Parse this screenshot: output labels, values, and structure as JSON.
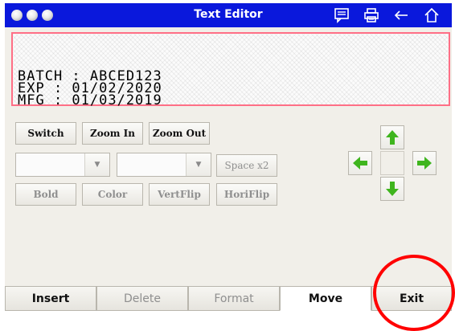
{
  "window": {
    "title": "Text Editor",
    "icons": [
      "traffic-light-dot",
      "message-icon",
      "printer-icon",
      "back-arrow-icon",
      "home-icon"
    ],
    "title_bar_color": "#0a18dc"
  },
  "preview": {
    "lines": [
      "BATCH : ABCED123",
      "EXP : 01/02/2020",
      "MFG : 01/03/2019"
    ],
    "border_color": "#ff6f86"
  },
  "toolbar": {
    "switch_label": "Switch",
    "zoom_in_label": "Zoom In",
    "zoom_out_label": "Zoom Out",
    "space_label": "Space x2",
    "bold_label": "Bold",
    "color_label": "Color",
    "vert_flip_label": "VertFlip",
    "hori_flip_label": "HoriFlip",
    "font_select_value": "",
    "size_select_value": ""
  },
  "move_pad": {
    "icons": [
      "arrow-up-icon",
      "arrow-left-icon",
      "arrow-right-icon",
      "arrow-down-icon"
    ],
    "arrow_color": "#3fb51e"
  },
  "tabs": [
    {
      "label": "Insert",
      "state": "enabled"
    },
    {
      "label": "Delete",
      "state": "disabled"
    },
    {
      "label": "Format",
      "state": "disabled"
    },
    {
      "label": "Move",
      "state": "active"
    },
    {
      "label": "Exit",
      "state": "enabled"
    }
  ],
  "annotation": {
    "highlight_color": "#ff0000",
    "target": "Exit"
  }
}
